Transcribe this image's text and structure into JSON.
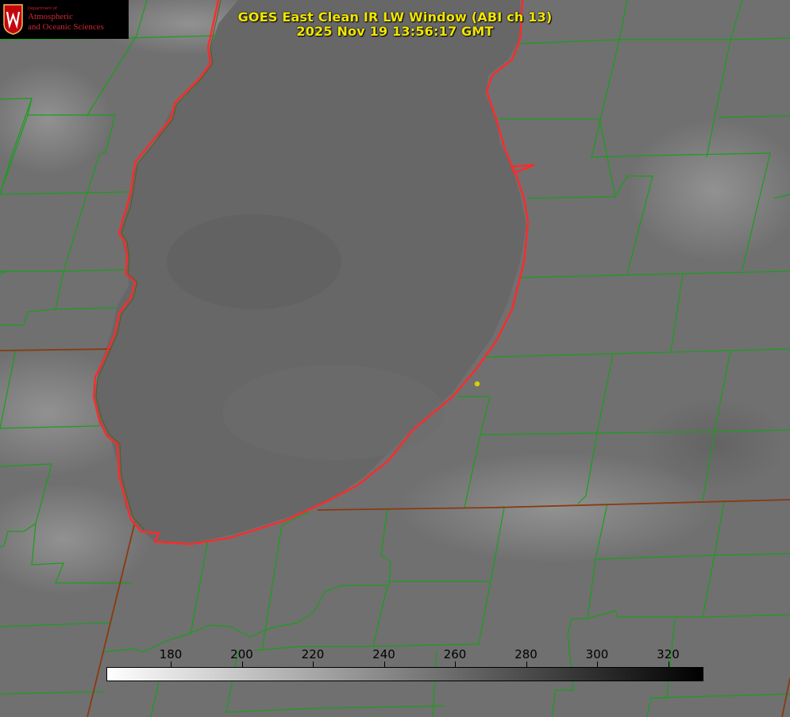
{
  "title": {
    "line1": "GOES East Clean IR LW Window (ABI ch 13)",
    "line2": "2025 Nov 19 13:56:17 GMT"
  },
  "logo": {
    "dept": "Department of",
    "name_line1": "Atmospheric",
    "name_line2": "and Oceanic Sciences",
    "crest_icon": "uw-crest-icon"
  },
  "colorbar": {
    "ticks": [
      "180",
      "200",
      "220",
      "240",
      "260",
      "280",
      "300",
      "320"
    ],
    "gradient_start": "#ffffff",
    "gradient_end": "#000000"
  },
  "colors": {
    "county_lines": "#1a9e1a",
    "coastline": "#ff2a2a",
    "state_line": "#8a3a10",
    "title": "#f2e600",
    "marker": "#d8d000"
  }
}
